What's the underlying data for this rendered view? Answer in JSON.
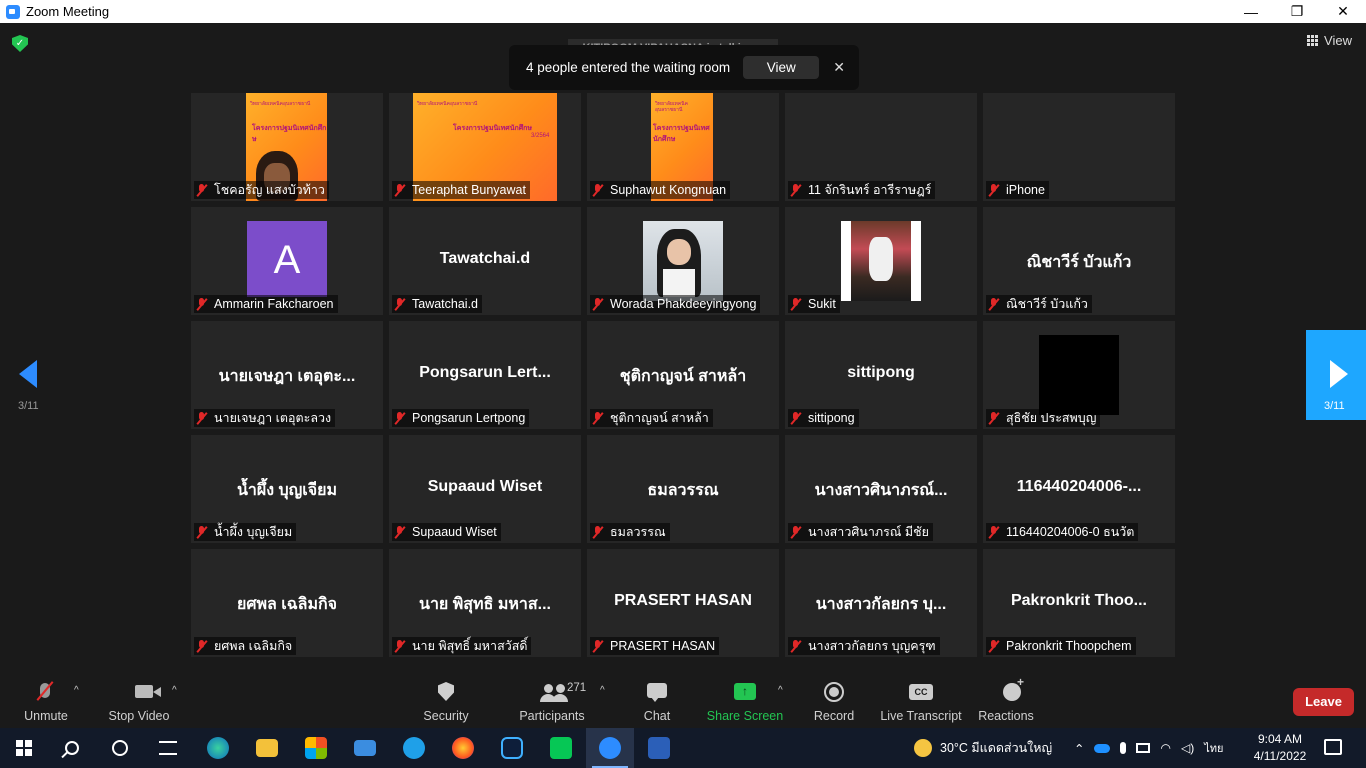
{
  "window": {
    "title": "Zoom Meeting",
    "minimize": "—",
    "restore": "❐",
    "close": "✕"
  },
  "top": {
    "view_label": "View",
    "talking": "KITIPOOM VIPAHASNA is talking...",
    "toast_message": "4 people entered the waiting room",
    "toast_button": "View",
    "toast_close": "✕"
  },
  "pagination": {
    "left_page": "3/11",
    "right_page": "3/11"
  },
  "tiles": [
    {
      "label": "โชคอรัญ แสงบัวท้าว",
      "center": ""
    },
    {
      "label": "Teeraphat Bunyawat",
      "center": ""
    },
    {
      "label": "Suphawut Kongnuan",
      "center": ""
    },
    {
      "label": "11 จักรินทร์ อารีราษฎร์",
      "center": ""
    },
    {
      "label": "iPhone",
      "center": ""
    },
    {
      "label": "Ammarin Fakcharoen",
      "center": "",
      "avatar_letter": "A"
    },
    {
      "label": "Tawatchai.d",
      "center": "Tawatchai.d"
    },
    {
      "label": "Worada Phakdeeyingyong",
      "center": ""
    },
    {
      "label": "Sukit",
      "center": ""
    },
    {
      "label": "ณิชาวีร์ บัวแก้ว",
      "center": "ณิชาวีร์ บัวแก้ว"
    },
    {
      "label": "นายเจษฎา เตอุตะลวง",
      "center": "นายเจษฎา เตอุตะ..."
    },
    {
      "label": "Pongsarun Lertpong",
      "center": "Pongsarun  Lert..."
    },
    {
      "label": "ชุติกาญจน์ สาหล้า",
      "center": "ชุติกาญจน์ สาหล้า"
    },
    {
      "label": "sittipong",
      "center": "sittipong"
    },
    {
      "label": "สุธิชัย ประสพบุญ",
      "center": ""
    },
    {
      "label": "น้ำผึ้ง บุญเจียม",
      "center": "น้ำผึ้ง บุญเจียม"
    },
    {
      "label": "Supaaud Wiset",
      "center": "Supaaud Wiset"
    },
    {
      "label": "ธมลวรรณ",
      "center": "ธมลวรรณ"
    },
    {
      "label": "นางสาวศินาภรณ์ มีชัย",
      "center": "นางสาวศินาภรณ์..."
    },
    {
      "label": "116440204006-0 ธนวัต",
      "center": "116440204006-..."
    },
    {
      "label": "ยศพล เฉลิมกิจ",
      "center": "ยศพล เฉลิมกิจ"
    },
    {
      "label": "นาย พิสุทธิ์ มหาสวัสดิ์",
      "center": "นาย พิสุทธิ มหาส..."
    },
    {
      "label": "PRASERT HASAN",
      "center": "PRASERT HASAN"
    },
    {
      "label": "นางสาวกัลยกร บุญครุฑ",
      "center": "นางสาวกัลยกร บุ..."
    },
    {
      "label": "Pakronkrit Thoopchem",
      "center": "Pakronkrit  Thoo..."
    }
  ],
  "slides": {
    "line_a": "วิทยาลัยเทคนิคอุบลราชธานี",
    "line_b": "โครงการปฐมนิเทศนักศึกษ",
    "line_c": "3/2564"
  },
  "toolbar": {
    "unmute": "Unmute",
    "stop_video": "Stop Video",
    "security": "Security",
    "participants": "Participants",
    "participants_count": "271",
    "chat": "Chat",
    "share_screen": "Share Screen",
    "record": "Record",
    "live_transcript": "Live Transcript",
    "cc": "CC",
    "reactions": "Reactions",
    "leave": "Leave",
    "caret": "^"
  },
  "taskbar": {
    "weather": "30°C  มีแดดส่วนใหญ่",
    "language": "ไทย",
    "time": "9:04 AM",
    "date": "4/11/2022"
  },
  "colors": {
    "accent": "#2d8cff",
    "share_green": "#23c552",
    "leave_red": "#c52a2a",
    "muted_red": "#e02828"
  }
}
